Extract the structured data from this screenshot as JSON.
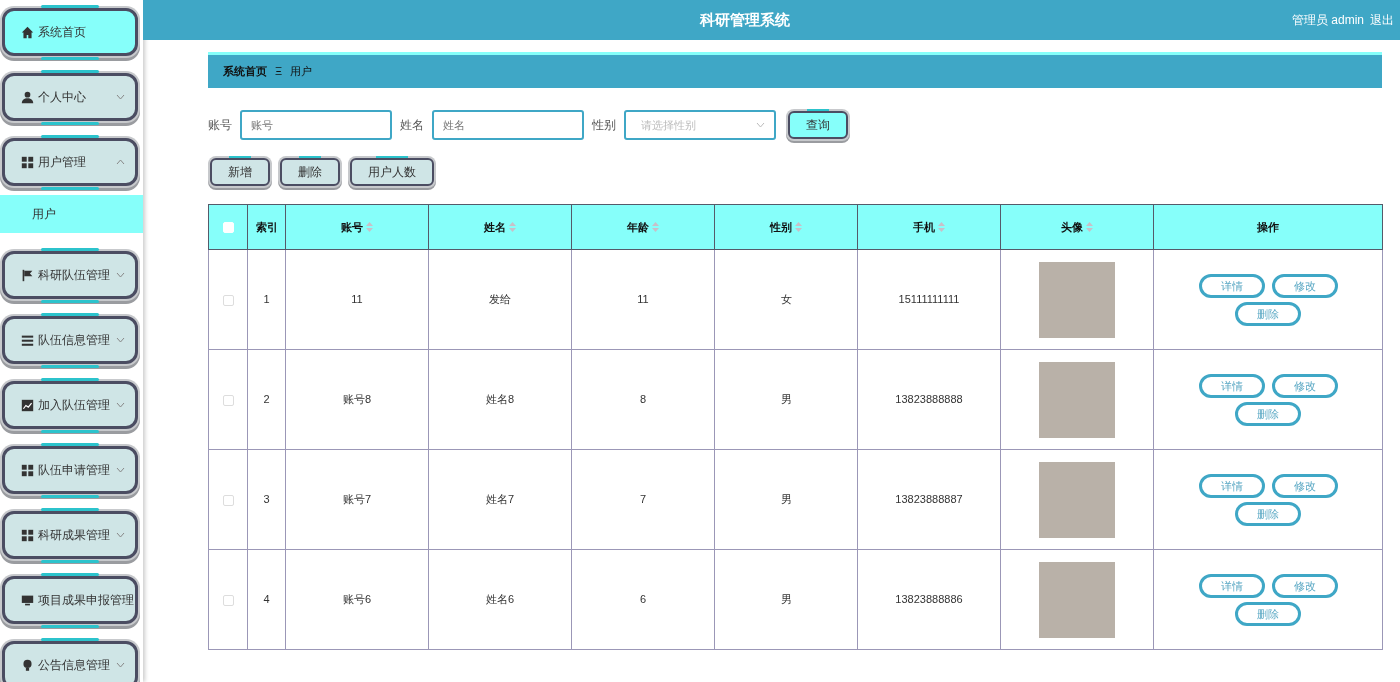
{
  "header": {
    "title": "科研管理系统",
    "user": "管理员 admin",
    "logout": "退出"
  },
  "sidebar": {
    "items": [
      {
        "label": "系统首页",
        "kind": "link",
        "selected": true
      },
      {
        "label": "个人中心",
        "kind": "submenu",
        "selected": false,
        "expanded": false
      },
      {
        "label": "用户管理",
        "kind": "submenu",
        "selected": false,
        "expanded": true,
        "children": [
          {
            "label": "用户",
            "selected": true
          }
        ]
      },
      {
        "label": "科研队伍管理",
        "kind": "submenu",
        "selected": false,
        "expanded": false
      },
      {
        "label": "队伍信息管理",
        "kind": "submenu",
        "selected": false,
        "expanded": false
      },
      {
        "label": "加入队伍管理",
        "kind": "submenu",
        "selected": false,
        "expanded": false
      },
      {
        "label": "队伍申请管理",
        "kind": "submenu",
        "selected": false,
        "expanded": false
      },
      {
        "label": "科研成果管理",
        "kind": "submenu",
        "selected": false,
        "expanded": false
      },
      {
        "label": "项目成果申报管理",
        "kind": "link",
        "selected": false
      },
      {
        "label": "公告信息管理",
        "kind": "submenu",
        "selected": false,
        "expanded": false
      }
    ]
  },
  "breadcrumb": {
    "items": [
      "系统首页",
      "用户"
    ],
    "separator": "Ξ"
  },
  "search": {
    "fields": [
      {
        "label": "账号",
        "placeholder": "账号",
        "kind": "text"
      },
      {
        "label": "姓名",
        "placeholder": "姓名",
        "kind": "text"
      },
      {
        "label": "性别",
        "placeholder": "请选择性别",
        "kind": "select"
      }
    ],
    "button": "查询"
  },
  "actions": [
    "新增",
    "删除",
    "用户人数"
  ],
  "table": {
    "select_all_checked": false,
    "columns": [
      {
        "label": "索引",
        "sortable": false
      },
      {
        "label": "账号",
        "sortable": true
      },
      {
        "label": "姓名",
        "sortable": true
      },
      {
        "label": "年龄",
        "sortable": true
      },
      {
        "label": "性别",
        "sortable": true
      },
      {
        "label": "手机",
        "sortable": true
      },
      {
        "label": "头像",
        "sortable": true
      },
      {
        "label": "操作",
        "sortable": false
      }
    ],
    "rows": [
      {
        "checked": false,
        "cells": [
          "1",
          "11",
          "发给",
          "11",
          "女",
          "15111111111"
        ],
        "actions": [
          "详情",
          "修改",
          "删除"
        ]
      },
      {
        "checked": false,
        "cells": [
          "2",
          "账号8",
          "姓名8",
          "8",
          "男",
          "13823888888"
        ],
        "actions": [
          "详情",
          "修改",
          "删除"
        ]
      },
      {
        "checked": false,
        "cells": [
          "3",
          "账号7",
          "姓名7",
          "7",
          "男",
          "13823888887"
        ],
        "actions": [
          "详情",
          "修改",
          "删除"
        ]
      },
      {
        "checked": false,
        "cells": [
          "4",
          "账号6",
          "姓名6",
          "6",
          "男",
          "13823888886"
        ],
        "actions": [
          "详情",
          "修改",
          "删除"
        ]
      }
    ]
  }
}
